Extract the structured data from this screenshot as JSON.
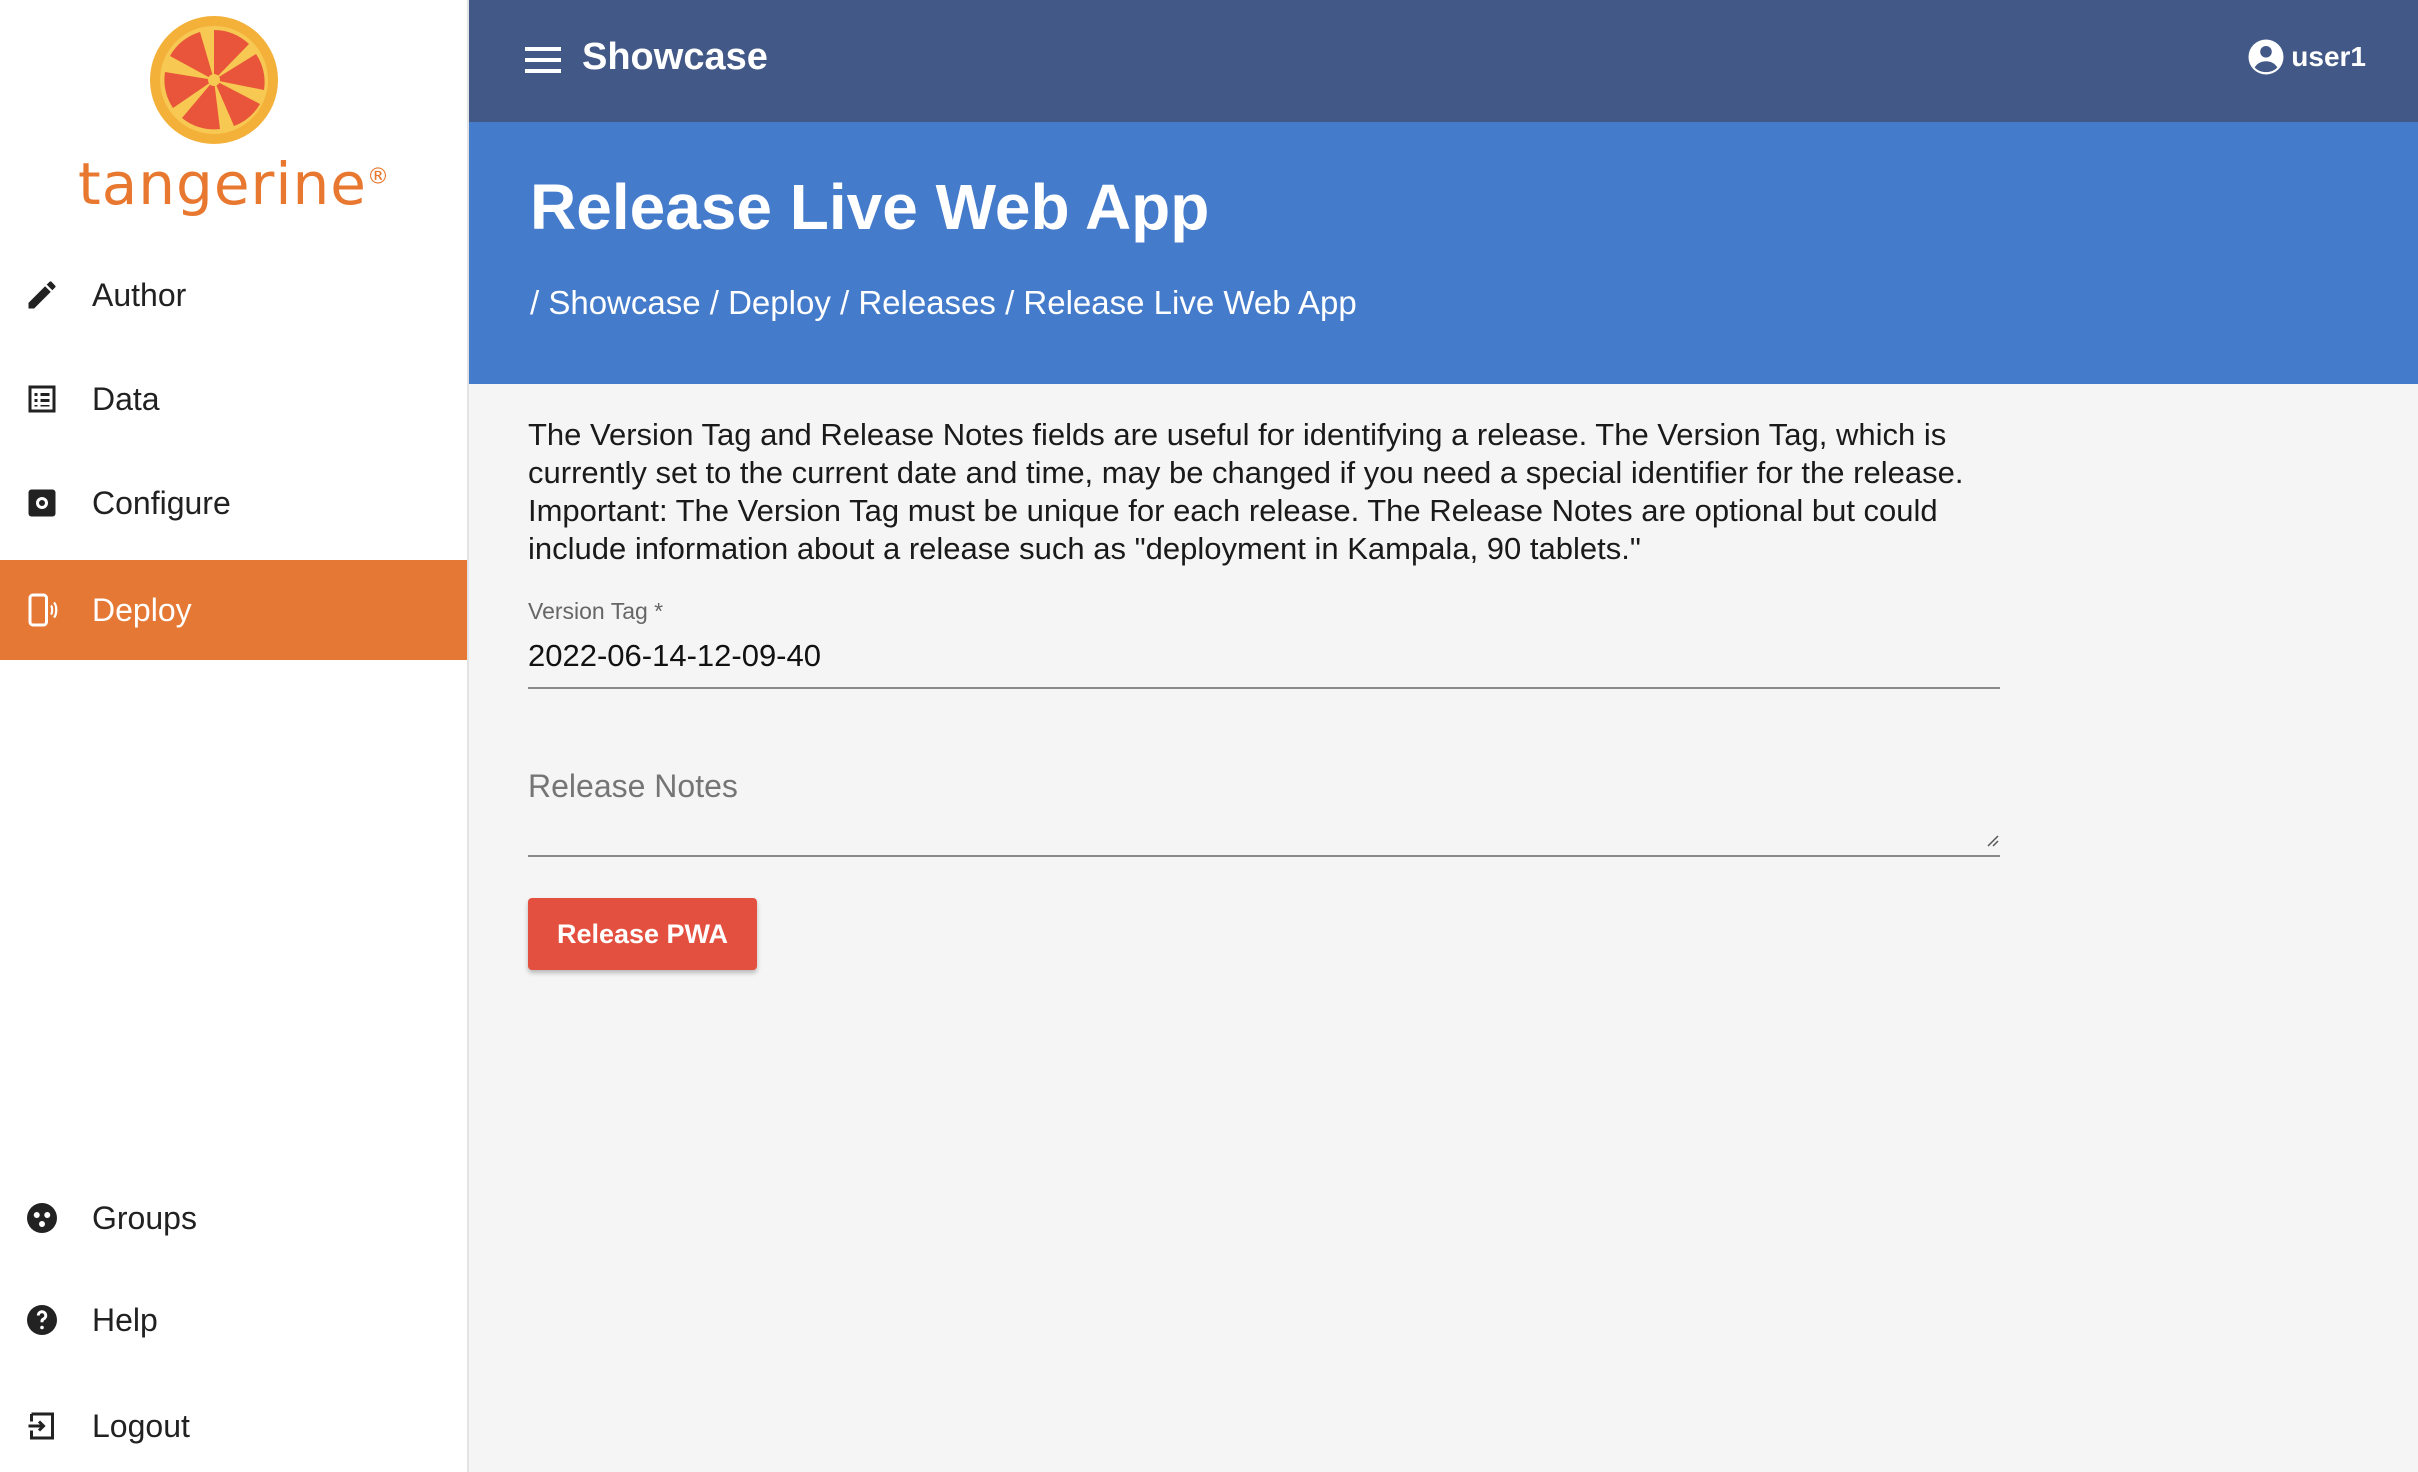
{
  "sidebar": {
    "logo_text": "tangerine",
    "logo_mark": "®",
    "items": [
      {
        "label": "Author",
        "icon": "pencil-icon"
      },
      {
        "label": "Data",
        "icon": "list-icon"
      },
      {
        "label": "Configure",
        "icon": "settings-icon"
      },
      {
        "label": "Deploy",
        "icon": "mobile-device-icon",
        "active": true
      },
      {
        "label": "Groups",
        "icon": "groups-icon"
      },
      {
        "label": "Help",
        "icon": "help-icon"
      },
      {
        "label": "Logout",
        "icon": "logout-icon"
      }
    ]
  },
  "topbar": {
    "title": "Showcase",
    "user": "user1"
  },
  "header": {
    "title": "Release Live Web App",
    "breadcrumb": "/ Showcase / Deploy / Releases / Release Live Web App"
  },
  "main": {
    "description": "The Version Tag and Release Notes fields are useful for identifying a release. The Version Tag, which is currently set to the current date and time, may be changed if you need a special identifier for the release. Important: The Version Tag must be unique for each release. The Release Notes are optional but could include information about a release such as \"deployment in Kampala, 90 tablets.\"",
    "version_tag_label": "Version Tag *",
    "version_tag_value": "2022-06-14-12-09-40",
    "release_notes_placeholder": "Release Notes",
    "release_button": "Release PWA"
  },
  "colors": {
    "topbar": "#425886",
    "header": "#447bcb",
    "active_nav": "#e57834",
    "button": "#e4503f"
  }
}
